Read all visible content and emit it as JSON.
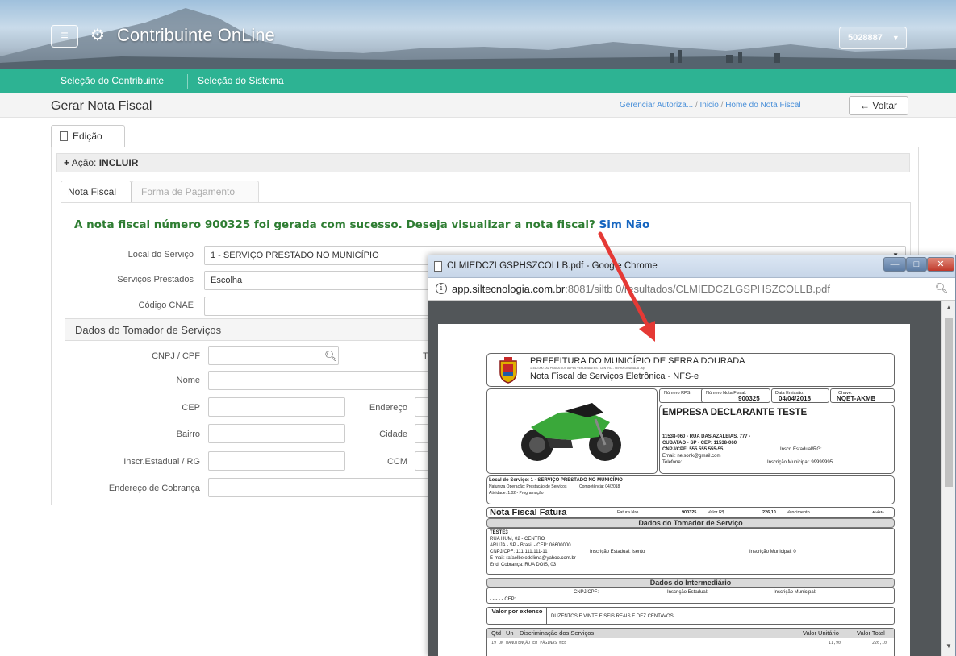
{
  "header": {
    "brand": "Contribuinte OnLine",
    "user": "5028887"
  },
  "nav": {
    "items": [
      "Seleção do Contribuinte",
      "Seleção do Sistema"
    ]
  },
  "page": {
    "title": "Gerar Nota Fiscal",
    "breadcrumbs": [
      "Gerenciar Autoriza...",
      "Inicio",
      "Home do Nota Fiscal"
    ],
    "back_label": "Voltar"
  },
  "edit_tab": "Edição",
  "acao": {
    "prefix": "Ação: ",
    "value": "INCLUIR"
  },
  "tabs": [
    "Nota Fiscal",
    "Forma de Pagamento"
  ],
  "success": {
    "message": "A nota fiscal número 900325 foi gerada com sucesso. Deseja visualizar a nota fiscal?",
    "yes": "Sim",
    "no": "Não"
  },
  "form": {
    "local_label": "Local do Serviço",
    "local_value": "1 - SERVIÇO PRESTADO NO MUNICÍPIO",
    "servicos_label": "Serviços Prestados",
    "servicos_value": "Escolha",
    "cnae_label": "Código CNAE",
    "section_tomador": "Dados do Tomador de Serviços",
    "cnpj_label": "CNPJ / CPF",
    "tipo_label": "Tip",
    "nome_label": "Nome",
    "cep_label": "CEP",
    "endereco_label": "Endereço",
    "bairro_label": "Bairro",
    "cidade_label": "Cidade",
    "inscr_label": "Inscr.Estadual / RG",
    "ccm_label": "CCM",
    "cobranca_label": "Endereço de Cobrança"
  },
  "popup": {
    "title": "CLMIEDCZLGSPHSZCOLLB.pdf - Google Chrome",
    "url_host": "app.siltecnologia.com.br",
    "url_rest": ":8081/siltb    0/resultados/CLMIEDCZLGSPHSZCOLLB.pdf"
  },
  "pdf": {
    "prefeitura": "PREFEITURA DO MUNICÍPIO DE SERRA DOURADA",
    "address_small": "11510-000 - AV PRAÇA DOS ALPES VERDEJANTES - CENTRO - SERRA DOURADA - sp",
    "nfse": "Nota Fiscal de Serviços Eletrônica - NFS-e",
    "numero_rps_label": "Número RPS:",
    "numero_nf_label": "Número Nota Fiscal:",
    "numero_nf": "900325",
    "data_emissao_label": "Data Emissão:",
    "data_emissao": "04/04/2018",
    "chave_label": "Chave:",
    "chave": "NQET-AKMB",
    "empresa": "EMPRESA DECLARANTE TESTE",
    "emp_end1": "11538-060 - RUA DAS AZALEIAS, 777 -",
    "emp_end2": "CUBATAO - SP - CEP: 11538-060",
    "emp_cnpj": "CNPJ/CPF: 555.555.555-55",
    "emp_inscr": "Inscr. Estadual/RG:",
    "emp_email": "Email:  nelsonk@gmail.com",
    "emp_tel": "Telefone:",
    "emp_munic": "Inscrição Municipal:  99999995",
    "local_serv": "Local do Serviço: 1 - SERVIÇO PRESTADO NO MUNICÍPIO",
    "natureza": "Natureza Operação: Prestação de Serviços",
    "competencia": "Competência: 04/2018",
    "atividade": "Atividade: 1.02 - Programação",
    "fatura_title": "Nota Fiscal Fatura",
    "fatura_nro_label": "Fatura Nro",
    "fatura_nro": "900325",
    "valor_label": "Valor R$",
    "valor": "226,10",
    "vencimento_label": "Vencimento",
    "vencimento": "A vista",
    "tomador_title": "Dados do Tomador de Serviço",
    "tom_nome": "TESTE3",
    "tom_rua": "RUA HUM, 02 - CENTRO",
    "tom_cidade": "ARUJA - SP  -  Brasil  -  CEP: 06600000",
    "tom_cnpj": "CNPJ/CPF: 111.111.111-11",
    "tom_inscr_est": "Inscrição Estadual:  isento",
    "tom_inscr_mun": "Inscrição Municipal:  0",
    "tom_email": "E-mail:  rafaelbelodelima@yahoo.com.br",
    "tom_cobranca": "End. Cobrança:  RUA DOIS, 03",
    "interm_title": "Dados do Intermediário",
    "interm_cnpj": "CNPJ/CPF:",
    "interm_inscr_est": "Inscrição Estadual:",
    "interm_inscr_mun": "Inscrição Municipal:",
    "interm_cep": "- - - -  - CEP:",
    "valor_extenso_label": "Valor por extenso",
    "valor_extenso": "DUZENTOS E VINTE E SEIS REAIS E DEZ CENTAVOS",
    "col_qtd": "Qtd",
    "col_un": "Un",
    "col_disc": "Discriminação dos Serviços",
    "col_vu": "Valor Unitário",
    "col_vt": "Valor Total",
    "row1": "19   UN  MANUTENÇÃO EM PÁGINAS WEB",
    "row1_vu": "11,90",
    "row1_vt": "226,10"
  },
  "colors": {
    "nav": "#2db393",
    "success": "#2e7d32",
    "link": "#1565c0",
    "arrow": "#e53935"
  }
}
